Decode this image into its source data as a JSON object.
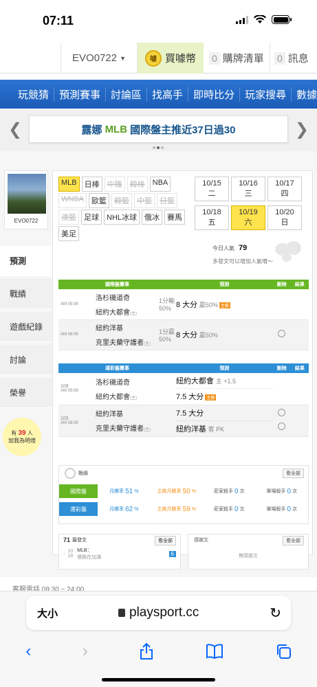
{
  "status": {
    "time": "07:11"
  },
  "topbar": {
    "username": "EVO0722",
    "buy_coin_label": "買噱幣",
    "cart_count": "0",
    "cart_label": "購牌清單",
    "msg_count": "0",
    "msg_label": "訊息"
  },
  "nav": {
    "items": [
      "玩競猜",
      "預測賽事",
      "討論區",
      "找高手",
      "即時比分",
      "玩家搜尋",
      "數據"
    ]
  },
  "banner": {
    "left": "露娜",
    "mid": "MLB",
    "right": "國際盤主推近37日過30"
  },
  "sidebar": {
    "avatar_name": "EVO0722",
    "tabs": [
      "預測",
      "戰績",
      "遊戲紀錄",
      "討論",
      "榮譽"
    ],
    "bulb_line1": "有",
    "bulb_count": "39",
    "bulb_unit": "人",
    "bulb_line2": "加我為明燈"
  },
  "league_chips": [
    {
      "label": "MLB",
      "state": "sel"
    },
    {
      "label": "日棒",
      "state": ""
    },
    {
      "label": "中職",
      "state": "dis"
    },
    {
      "label": "韓棒",
      "state": "dis"
    },
    {
      "label": "NBA",
      "state": ""
    },
    {
      "label": "WNBA",
      "state": "dis"
    },
    {
      "label": "歐籃",
      "state": ""
    },
    {
      "label": "韓籃",
      "state": "dis"
    },
    {
      "label": "中籃",
      "state": "dis"
    },
    {
      "label": "日籃",
      "state": "dis"
    },
    {
      "label": "澳籃",
      "state": "dis"
    },
    {
      "label": "足球",
      "state": ""
    },
    {
      "label": "NHL冰球",
      "state": ""
    },
    {
      "label": "俄冰",
      "state": ""
    },
    {
      "label": "賽馬",
      "state": ""
    },
    {
      "label": "美足",
      "state": ""
    }
  ],
  "dates": [
    {
      "label": "10/15 二",
      "state": ""
    },
    {
      "label": "10/16 三",
      "state": ""
    },
    {
      "label": "10/17 四",
      "state": ""
    },
    {
      "label": "10/18 五",
      "state": ""
    },
    {
      "label": "10/19 六",
      "state": "sel"
    },
    {
      "label": "10/20 日",
      "state": ""
    }
  ],
  "popularity": {
    "label": "今日人氣",
    "value": "79",
    "hint": "多發文可以增加人氣唷～"
  },
  "intl": {
    "headers": [
      "國際盤賽事",
      "預測",
      "刪除",
      "結果"
    ],
    "rows": [
      {
        "time": "AM 05:08",
        "team1": "洛杉磯道奇",
        "team2": "紐約大都會",
        "home_mark": "(主)",
        "line": "1分輸",
        "pct": "50%",
        "pick": "8 大分",
        "win": "贏50%",
        "badge": "主推",
        "radio": false
      },
      {
        "time": "AM 08:08",
        "team1": "紐約洋基",
        "team2": "克里夫蘭守護者",
        "home_mark": "(主)",
        "line": "1分贏",
        "pct": "50%",
        "pick": "8 大分",
        "win": "贏50%",
        "badge": "",
        "radio": true
      }
    ]
  },
  "sports": {
    "headers": [
      "運彩盤賽事",
      "預測",
      "刪除",
      "結果"
    ],
    "rows": [
      {
        "num": "108",
        "time": "AM 05:08",
        "team1": "洛杉磯道奇",
        "team2": "紐約大都會",
        "home_mark": "(主)",
        "pick1": "紐約大都會",
        "pick1_extra": "主 +1.5",
        "pick2": "7.5 大分",
        "pick2_badge": "主推",
        "radio1": false,
        "radio2": false
      },
      {
        "num": "105",
        "time": "AM 08:08",
        "team1": "紐約洋基",
        "team2": "克里夫蘭守護者",
        "home_mark": "(主)",
        "pick1": "7.5 大分",
        "pick1_extra": "",
        "pick2": "紐約洋基",
        "pick2_extra": "客 PK",
        "radio1": true,
        "radio2": true
      }
    ]
  },
  "stats": {
    "title": "戰績",
    "see_all": "看全部",
    "rows": [
      {
        "label": "國際盤",
        "color": "#66b623",
        "monthly_label": "月勝率",
        "monthly": "51",
        "main_label": "主推月勝率",
        "main": "50",
        "chain_label": "莊家殺手",
        "chain": "0",
        "chain_unit": "次",
        "single_label": "單場殺手",
        "single": "0",
        "single_unit": "次"
      },
      {
        "label": "運彩盤",
        "color": "#2d8fd6",
        "monthly_label": "月勝率",
        "monthly": "62",
        "main_label": "主推月勝率",
        "main": "59",
        "chain_label": "莊家殺手",
        "chain": "0",
        "chain_unit": "次",
        "single_label": "單場殺手",
        "single": "0",
        "single_unit": "次"
      }
    ]
  },
  "posts": {
    "count": "71",
    "label": "篇發文",
    "see_all": "看全部",
    "date_top": "10",
    "date_bottom": "18",
    "league": "MLB：",
    "snippet": "債務在加滿",
    "chip": "6"
  },
  "thanks": {
    "title": "感謝文",
    "see_all": "看全部",
    "empty": "無感謝文"
  },
  "service": "客服電話 09:30 ~ 24:00",
  "browser": {
    "aa": "大小",
    "url": "playsport.cc"
  }
}
